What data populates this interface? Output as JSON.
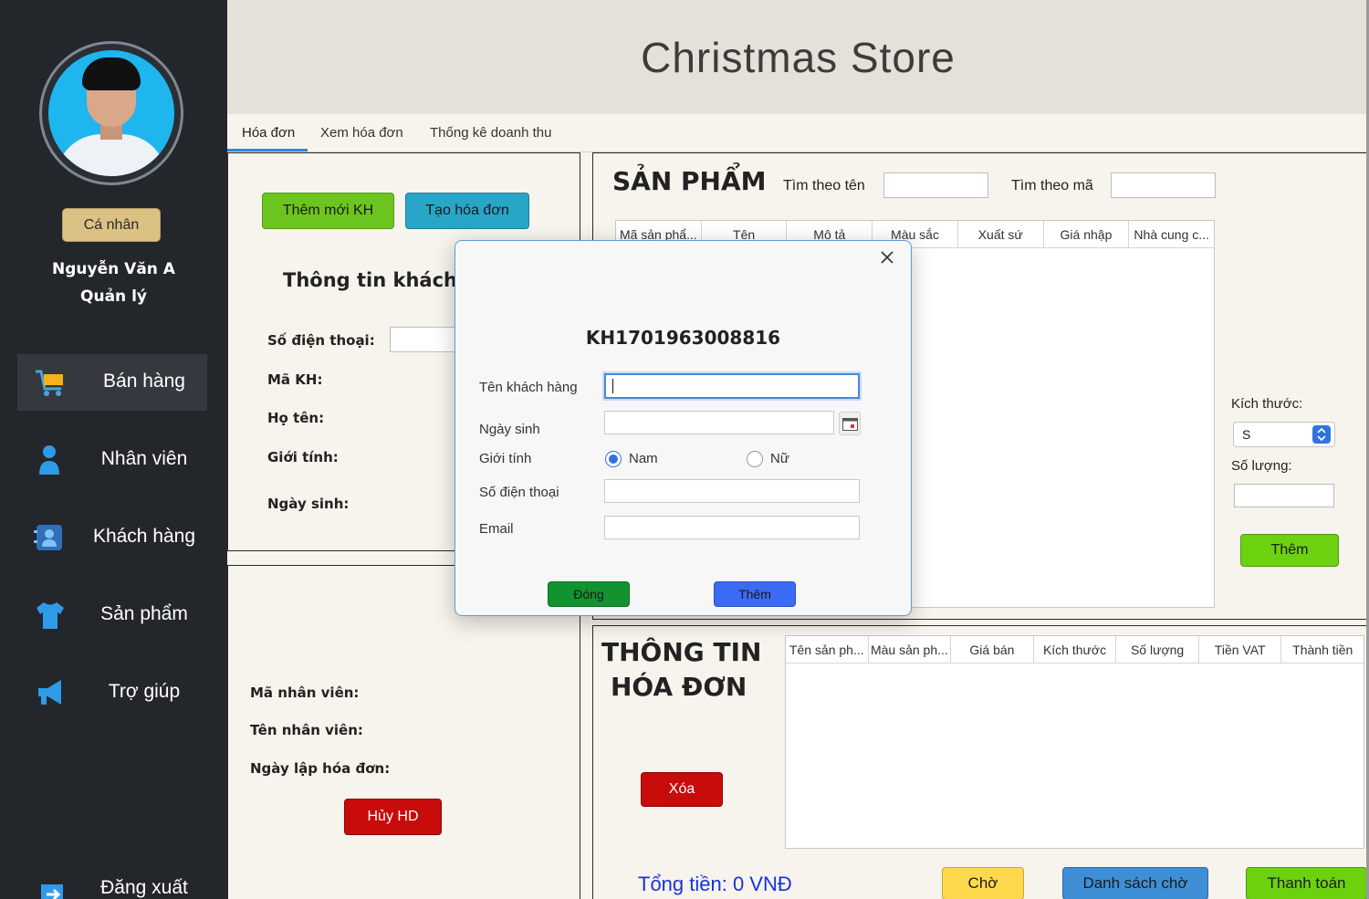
{
  "app": {
    "title": "Christmas Store"
  },
  "sidebar": {
    "personal_button": "Cá nhân",
    "user_name": "Nguyễn Văn A",
    "user_role": "Quản lý",
    "items": [
      {
        "label": "Bán hàng",
        "icon": "cart-icon"
      },
      {
        "label": "Nhân viên",
        "icon": "person-icon"
      },
      {
        "label": "Khách hàng",
        "icon": "contact-card-icon"
      },
      {
        "label": "Sản phẩm",
        "icon": "shirt-icon"
      },
      {
        "label": "Trợ giúp",
        "icon": "megaphone-icon"
      },
      {
        "label": "Đăng xuất",
        "icon": "logout-icon"
      }
    ]
  },
  "tabs": [
    "Hóa đơn",
    "Xem hóa đơn",
    "Thống kê doanh thu"
  ],
  "customer": {
    "add_customer_button": "Thêm mới KH",
    "create_invoice_button": "Tạo hóa đơn",
    "heading": "Thông tin khách h",
    "phone_label": "Số điện thoại:",
    "id_label": "Mã KH:",
    "name_label": "Họ tên:",
    "gender_label": "Giới tính:",
    "dob_label": "Ngày sinh:"
  },
  "employee": {
    "id_label": "Mã nhân viên:",
    "name_label": "Tên nhân viên:",
    "date_label": "Ngày lập hóa đơn:",
    "cancel_button": "Hủy HD"
  },
  "products": {
    "heading": "SẢN PHẨM",
    "search_name_label": "Tìm theo tên",
    "search_code_label": "Tìm theo mã",
    "columns": [
      "Mã sản phẩ...",
      "Tên",
      "Mô tả",
      "Màu sắc",
      "Xuất sứ",
      "Giá nhập",
      "Nhà cung c..."
    ],
    "size_label": "Kích thước:",
    "size_value": "S",
    "quantity_label": "Số lượng:",
    "add_button": "Thêm"
  },
  "invoice": {
    "heading_line1": "THÔNG TIN",
    "heading_line2": "HÓA ĐƠN",
    "columns": [
      "Tên sản ph...",
      "Màu sản ph...",
      "Giá bán",
      "Kích thước",
      "Số lượng",
      "Tiền VAT",
      "Thành tiền"
    ],
    "delete_button": "Xóa",
    "total": "Tổng tiền: 0 VNĐ",
    "wait_button": "Chờ",
    "wait_list_button": "Danh sách chờ",
    "pay_button": "Thanh toán"
  },
  "modal": {
    "customer_id": "KH1701963008816",
    "name_label": "Tên khách hàng",
    "dob_label": "Ngày sinh",
    "gender_label": "Giới tính",
    "gender_male": "Nam",
    "gender_female": "Nữ",
    "gender_selected": "Nam",
    "phone_label": "Số điện thoại",
    "email_label": "Email",
    "close_button": "Đóng",
    "add_button": "Thêm",
    "close_icon": "close-icon",
    "calendar_icon": "calendar-icon"
  },
  "colors": {
    "sidebar_bg": "#23262b",
    "green": "#6cc51f",
    "teal": "#29a5c7",
    "red": "#c80b0b",
    "blue": "#3b6af5",
    "yellow": "#fed94e",
    "dark_green": "#12932f",
    "accent": "#2f86d8"
  }
}
